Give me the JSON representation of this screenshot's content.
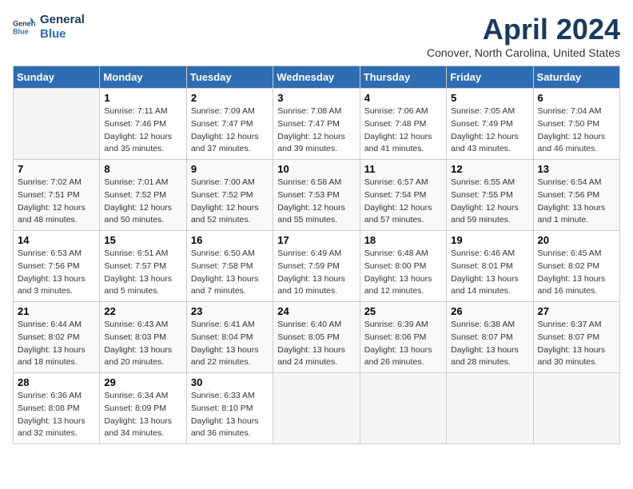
{
  "header": {
    "logo_line1": "General",
    "logo_line2": "Blue",
    "month": "April 2024",
    "location": "Conover, North Carolina, United States"
  },
  "columns": [
    "Sunday",
    "Monday",
    "Tuesday",
    "Wednesday",
    "Thursday",
    "Friday",
    "Saturday"
  ],
  "weeks": [
    [
      {
        "day": "",
        "info": ""
      },
      {
        "day": "1",
        "info": "Sunrise: 7:11 AM\nSunset: 7:46 PM\nDaylight: 12 hours\nand 35 minutes."
      },
      {
        "day": "2",
        "info": "Sunrise: 7:09 AM\nSunset: 7:47 PM\nDaylight: 12 hours\nand 37 minutes."
      },
      {
        "day": "3",
        "info": "Sunrise: 7:08 AM\nSunset: 7:47 PM\nDaylight: 12 hours\nand 39 minutes."
      },
      {
        "day": "4",
        "info": "Sunrise: 7:06 AM\nSunset: 7:48 PM\nDaylight: 12 hours\nand 41 minutes."
      },
      {
        "day": "5",
        "info": "Sunrise: 7:05 AM\nSunset: 7:49 PM\nDaylight: 12 hours\nand 43 minutes."
      },
      {
        "day": "6",
        "info": "Sunrise: 7:04 AM\nSunset: 7:50 PM\nDaylight: 12 hours\nand 46 minutes."
      }
    ],
    [
      {
        "day": "7",
        "info": "Sunrise: 7:02 AM\nSunset: 7:51 PM\nDaylight: 12 hours\nand 48 minutes."
      },
      {
        "day": "8",
        "info": "Sunrise: 7:01 AM\nSunset: 7:52 PM\nDaylight: 12 hours\nand 50 minutes."
      },
      {
        "day": "9",
        "info": "Sunrise: 7:00 AM\nSunset: 7:52 PM\nDaylight: 12 hours\nand 52 minutes."
      },
      {
        "day": "10",
        "info": "Sunrise: 6:58 AM\nSunset: 7:53 PM\nDaylight: 12 hours\nand 55 minutes."
      },
      {
        "day": "11",
        "info": "Sunrise: 6:57 AM\nSunset: 7:54 PM\nDaylight: 12 hours\nand 57 minutes."
      },
      {
        "day": "12",
        "info": "Sunrise: 6:55 AM\nSunset: 7:55 PM\nDaylight: 12 hours\nand 59 minutes."
      },
      {
        "day": "13",
        "info": "Sunrise: 6:54 AM\nSunset: 7:56 PM\nDaylight: 13 hours\nand 1 minute."
      }
    ],
    [
      {
        "day": "14",
        "info": "Sunrise: 6:53 AM\nSunset: 7:56 PM\nDaylight: 13 hours\nand 3 minutes."
      },
      {
        "day": "15",
        "info": "Sunrise: 6:51 AM\nSunset: 7:57 PM\nDaylight: 13 hours\nand 5 minutes."
      },
      {
        "day": "16",
        "info": "Sunrise: 6:50 AM\nSunset: 7:58 PM\nDaylight: 13 hours\nand 7 minutes."
      },
      {
        "day": "17",
        "info": "Sunrise: 6:49 AM\nSunset: 7:59 PM\nDaylight: 13 hours\nand 10 minutes."
      },
      {
        "day": "18",
        "info": "Sunrise: 6:48 AM\nSunset: 8:00 PM\nDaylight: 13 hours\nand 12 minutes."
      },
      {
        "day": "19",
        "info": "Sunrise: 6:46 AM\nSunset: 8:01 PM\nDaylight: 13 hours\nand 14 minutes."
      },
      {
        "day": "20",
        "info": "Sunrise: 6:45 AM\nSunset: 8:02 PM\nDaylight: 13 hours\nand 16 minutes."
      }
    ],
    [
      {
        "day": "21",
        "info": "Sunrise: 6:44 AM\nSunset: 8:02 PM\nDaylight: 13 hours\nand 18 minutes."
      },
      {
        "day": "22",
        "info": "Sunrise: 6:43 AM\nSunset: 8:03 PM\nDaylight: 13 hours\nand 20 minutes."
      },
      {
        "day": "23",
        "info": "Sunrise: 6:41 AM\nSunset: 8:04 PM\nDaylight: 13 hours\nand 22 minutes."
      },
      {
        "day": "24",
        "info": "Sunrise: 6:40 AM\nSunset: 8:05 PM\nDaylight: 13 hours\nand 24 minutes."
      },
      {
        "day": "25",
        "info": "Sunrise: 6:39 AM\nSunset: 8:06 PM\nDaylight: 13 hours\nand 26 minutes."
      },
      {
        "day": "26",
        "info": "Sunrise: 6:38 AM\nSunset: 8:07 PM\nDaylight: 13 hours\nand 28 minutes."
      },
      {
        "day": "27",
        "info": "Sunrise: 6:37 AM\nSunset: 8:07 PM\nDaylight: 13 hours\nand 30 minutes."
      }
    ],
    [
      {
        "day": "28",
        "info": "Sunrise: 6:36 AM\nSunset: 8:08 PM\nDaylight: 13 hours\nand 32 minutes."
      },
      {
        "day": "29",
        "info": "Sunrise: 6:34 AM\nSunset: 8:09 PM\nDaylight: 13 hours\nand 34 minutes."
      },
      {
        "day": "30",
        "info": "Sunrise: 6:33 AM\nSunset: 8:10 PM\nDaylight: 13 hours\nand 36 minutes."
      },
      {
        "day": "",
        "info": ""
      },
      {
        "day": "",
        "info": ""
      },
      {
        "day": "",
        "info": ""
      },
      {
        "day": "",
        "info": ""
      }
    ]
  ]
}
